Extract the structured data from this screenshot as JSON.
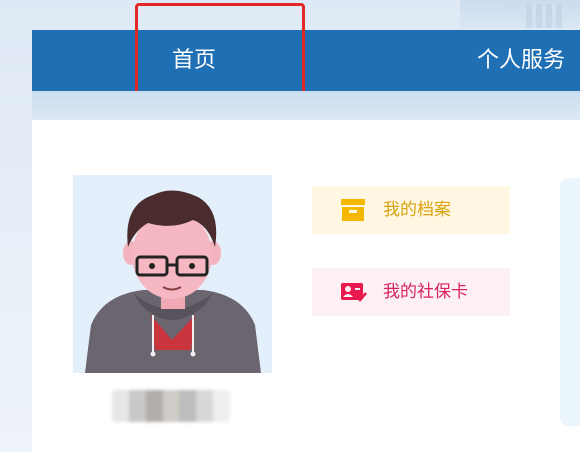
{
  "nav": {
    "items": [
      {
        "label": "首页"
      },
      {
        "label": "个人服务"
      }
    ]
  },
  "quick_links": [
    {
      "label": "我的档案",
      "icon": "archive-box-icon",
      "color": "#F5B800"
    },
    {
      "label": "我的社保卡",
      "icon": "id-card-check-icon",
      "color": "#E8194F"
    }
  ],
  "colors": {
    "nav_bg": "#1F6FB5",
    "highlight": "#E32626",
    "archive_bg": "#FFF7E1",
    "card_bg": "#FDF0F4"
  }
}
